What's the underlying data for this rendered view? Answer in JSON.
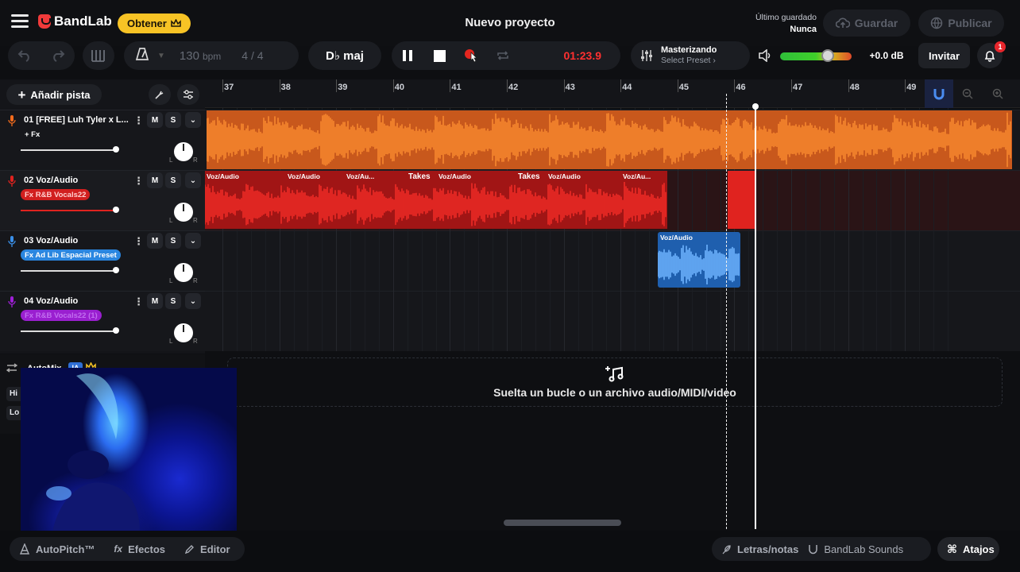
{
  "header": {
    "brand": "BandLab",
    "get_button": "Obtener",
    "project_title": "Nuevo proyecto",
    "last_saved_label": "Último guardado",
    "last_saved_value": "Nunca",
    "save_button": "Guardar",
    "publish_button": "Publicar"
  },
  "transport": {
    "tempo_value": "130",
    "tempo_unit": "bpm",
    "time_signature": "4 / 4",
    "key": "D♭ maj",
    "time": "01:23.9",
    "mastering_title": "Masterizando",
    "mastering_preset": "Select Preset ›",
    "volume_db": "+0.0 dB",
    "invite_button": "Invitar",
    "notification_count": "1"
  },
  "panel": {
    "add_track": "Añadir pista",
    "automix_label": "AutoMix",
    "automix_ia": "IA",
    "automix_row1": "Hi",
    "automix_row2": "Lo"
  },
  "tracks": [
    {
      "name": "01  [FREE] Luh Tyler x L...",
      "fx": "+ Fx",
      "color": "#f26b1d",
      "mute": "M",
      "solo": "S"
    },
    {
      "name": "02  Voz/Audio",
      "fx": "Fx R&B Vocals22",
      "color": "#e0231f",
      "mute": "M",
      "solo": "S"
    },
    {
      "name": "03  Voz/Audio",
      "fx": "Fx Ad Lib Espacial Preset",
      "color": "#3a8fe8",
      "mute": "M",
      "solo": "S"
    },
    {
      "name": "04  Voz/Audio",
      "fx": "Fx R&B Vocals22 (1)",
      "color": "#a020d8",
      "mute": "M",
      "solo": "S"
    }
  ],
  "ruler": {
    "bars": [
      "37",
      "38",
      "39",
      "40",
      "41",
      "42",
      "43",
      "44",
      "45",
      "46",
      "47",
      "48",
      "49"
    ]
  },
  "clips": {
    "track2_labels": [
      "Voz/Audio",
      "Voz/Audio",
      "Voz/Au...",
      "Takes",
      "Voz/Audio",
      "Takes",
      "Voz/Audio",
      "Voz/Au..."
    ],
    "track3_label": "Voz/Audio"
  },
  "drop_zone": {
    "text": "Suelta un bucle o un archivo audio/MIDI/video"
  },
  "bottom": {
    "autopitch": "AutoPitch™",
    "effects": "Efectos",
    "editor": "Editor",
    "lyrics": "Letras/notas",
    "sounds": "BandLab Sounds",
    "shortcuts": "Atajos"
  },
  "colors": {
    "accent_yellow": "#f7c325",
    "record_red": "#ff3030",
    "track1": "#f26b1d",
    "track2": "#e0231f",
    "track3": "#3a8fe8",
    "track4": "#a020d8"
  }
}
